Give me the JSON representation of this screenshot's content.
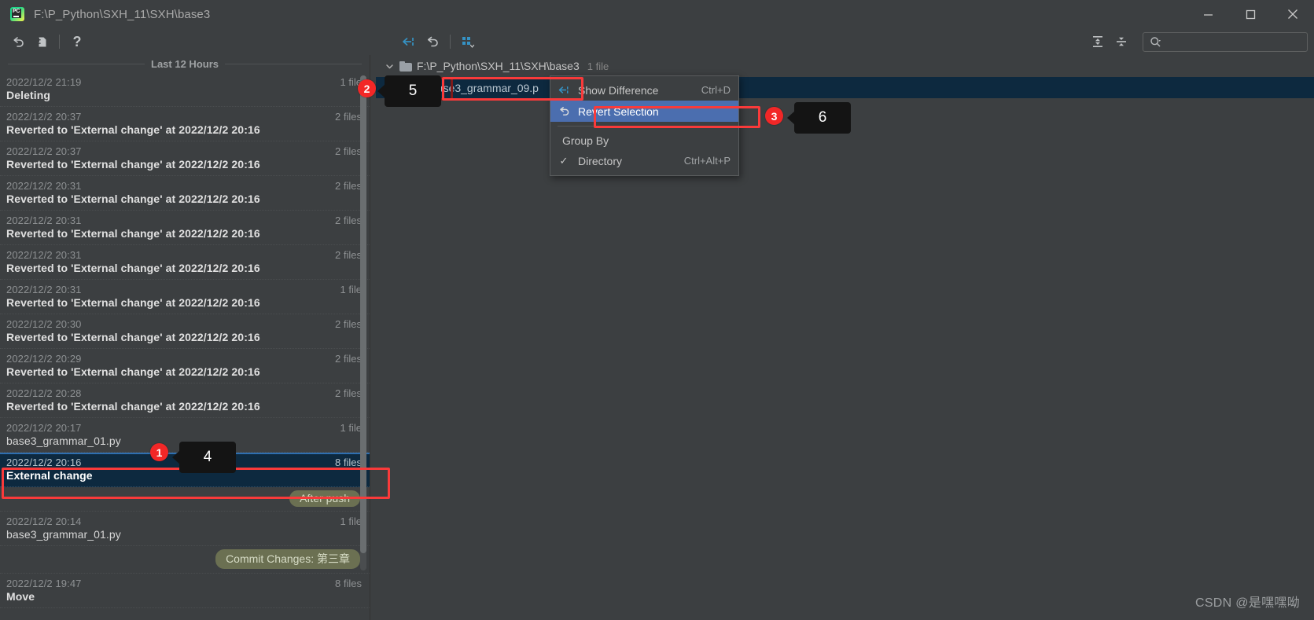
{
  "window": {
    "title": "F:\\P_Python\\SXH_11\\SXH\\base3",
    "app_icon": "pycharm-logo-icon",
    "minimize_label": "–",
    "maximize_label": "□",
    "close_label": "×"
  },
  "toolbar": {
    "revert_icon": "undo-arrow-icon",
    "create_patch_icon": "create-patch-icon",
    "help_icon": "help-question-icon",
    "show_difference_icon": "show-difference-icon",
    "revert_icon2": "revert-arrow-icon",
    "group_by_icon": "group-by-icon",
    "expand_all_icon": "expand-all-icon",
    "collapse_all_icon": "collapse-all-icon",
    "search_icon": "search-magnifier-icon",
    "search_value": "",
    "search_placeholder": ""
  },
  "left_panel": {
    "section_title": "Last 12 Hours",
    "revisions": [
      {
        "date": "2022/12/2 21:19",
        "count": "1 file",
        "label": "Deleting",
        "bold": true,
        "selected": false
      },
      {
        "date": "2022/12/2 20:37",
        "count": "2 files",
        "label": "Reverted to 'External change' at 2022/12/2 20:16",
        "bold": true,
        "selected": false
      },
      {
        "date": "2022/12/2 20:37",
        "count": "2 files",
        "label": "Reverted to 'External change' at 2022/12/2 20:16",
        "bold": true,
        "selected": false
      },
      {
        "date": "2022/12/2 20:31",
        "count": "2 files",
        "label": "Reverted to 'External change' at 2022/12/2 20:16",
        "bold": true,
        "selected": false
      },
      {
        "date": "2022/12/2 20:31",
        "count": "2 files",
        "label": "Reverted to 'External change' at 2022/12/2 20:16",
        "bold": true,
        "selected": false
      },
      {
        "date": "2022/12/2 20:31",
        "count": "2 files",
        "label": "Reverted to 'External change' at 2022/12/2 20:16",
        "bold": true,
        "selected": false
      },
      {
        "date": "2022/12/2 20:31",
        "count": "1 file",
        "label": "Reverted to 'External change' at 2022/12/2 20:16",
        "bold": true,
        "selected": false
      },
      {
        "date": "2022/12/2 20:30",
        "count": "2 files",
        "label": "Reverted to 'External change' at 2022/12/2 20:16",
        "bold": true,
        "selected": false
      },
      {
        "date": "2022/12/2 20:29",
        "count": "2 files",
        "label": "Reverted to 'External change' at 2022/12/2 20:16",
        "bold": true,
        "selected": false
      },
      {
        "date": "2022/12/2 20:28",
        "count": "2 files",
        "label": "Reverted to 'External change' at 2022/12/2 20:16",
        "bold": true,
        "selected": false
      },
      {
        "date": "2022/12/2 20:17",
        "count": "1 file",
        "label": "base3_grammar_01.py",
        "bold": false,
        "selected": false
      },
      {
        "date": "2022/12/2 20:16",
        "count": "8 files",
        "label": "External change",
        "bold": true,
        "selected": true
      },
      {
        "tag": "After push"
      },
      {
        "date": "2022/12/2 20:14",
        "count": "1 file",
        "label": "base3_grammar_01.py",
        "bold": false,
        "selected": false
      },
      {
        "tag": "Commit Changes: 第三章"
      },
      {
        "date": "2022/12/2 19:47",
        "count": "8 files",
        "label": "Move",
        "bold": true,
        "selected": false
      }
    ]
  },
  "right_panel": {
    "tree": {
      "chevron": "chevron-down-icon",
      "folder_icon": "folder-icon",
      "path": "F:\\P_Python\\SXH_11\\SXH\\base3",
      "file_count": "1 file",
      "file_icon": "python-file-icon",
      "file_name": "base3_grammar_09.p"
    }
  },
  "context_menu": {
    "items": [
      {
        "icon": "show-difference-icon",
        "label": "Show Difference",
        "shortcut": "Ctrl+D",
        "highlighted": false
      },
      {
        "icon": "revert-arrow-icon",
        "label": "Revert Selection",
        "shortcut": "",
        "highlighted": true
      }
    ],
    "group_header": "Group By",
    "group_items": [
      {
        "check": "✓",
        "label": "Directory",
        "shortcut": "Ctrl+Alt+P"
      }
    ]
  },
  "annotations": {
    "badges": [
      {
        "n": "1"
      },
      {
        "n": "2"
      },
      {
        "n": "3"
      }
    ],
    "callouts": [
      {
        "n": "4"
      },
      {
        "n": "5"
      },
      {
        "n": "6"
      }
    ]
  },
  "watermark": "CSDN @是嘿嘿呦"
}
